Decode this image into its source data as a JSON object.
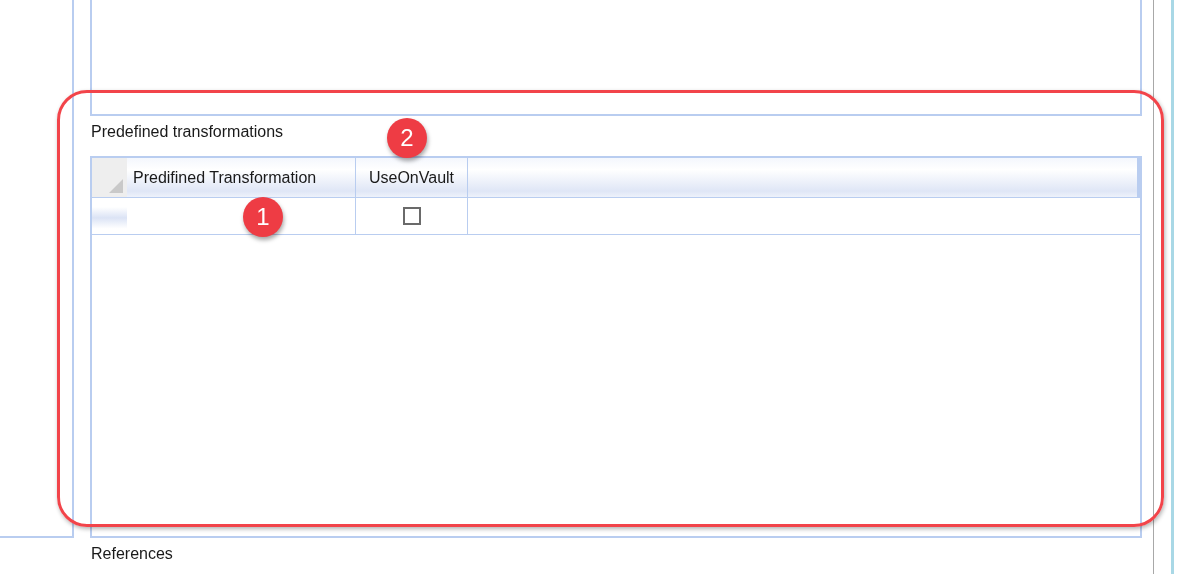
{
  "predefined": {
    "label": "Predefined transformations",
    "columns": [
      "Predifined Transformation",
      "UseOnVault"
    ],
    "rows": [
      {
        "use_on_vault": false
      }
    ]
  },
  "references_label": "References",
  "callouts": [
    {
      "number": "1"
    },
    {
      "number": "2"
    }
  ]
}
